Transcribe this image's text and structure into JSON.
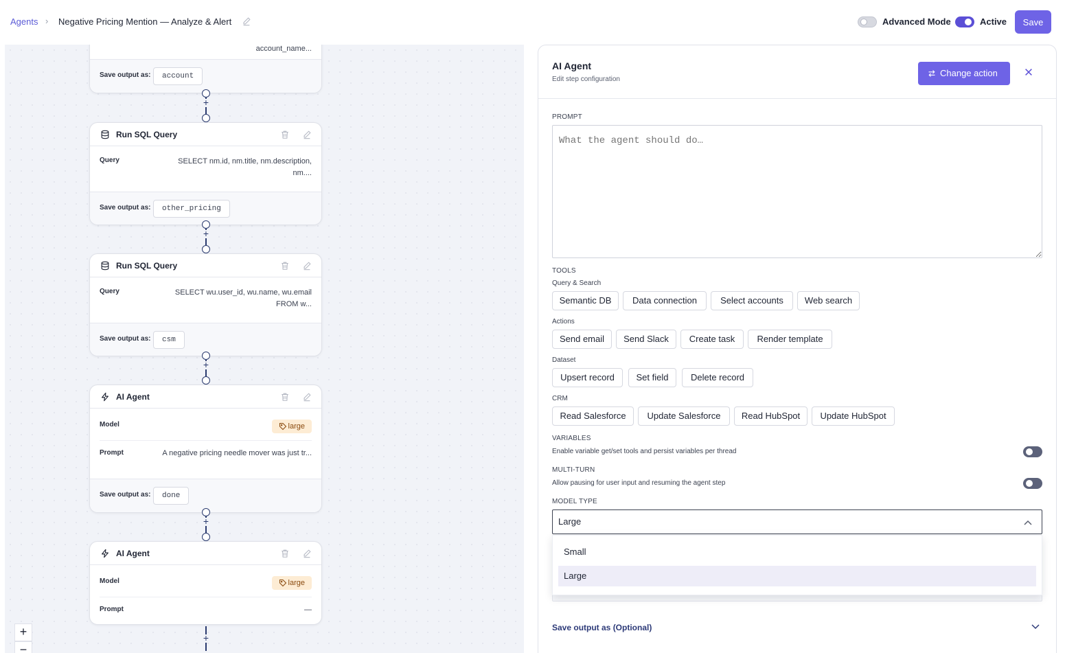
{
  "header": {
    "breadcrumb_root": "Agents",
    "title": "Negative Pricing Mention — Analyze & Alert",
    "advanced_mode_label": "Advanced Mode",
    "advanced_mode_on": false,
    "active_label": "Active",
    "active_on": true,
    "save_label": "Save"
  },
  "canvas": {
    "nodes": [
      {
        "title": "",
        "partial_value": "account_name...",
        "save_label": "Save output as:",
        "save_value": "account"
      },
      {
        "title": "Run SQL Query",
        "icon": "database-icon",
        "rows": [
          {
            "label": "Query",
            "value": "SELECT nm.id, nm.title, nm.description, nm...."
          }
        ],
        "save_label": "Save output as:",
        "save_value": "other_pricing"
      },
      {
        "title": "Run SQL Query",
        "icon": "database-icon",
        "rows": [
          {
            "label": "Query",
            "value": "SELECT wu.user_id, wu.name, wu.email FROM w..."
          }
        ],
        "save_label": "Save output as:",
        "save_value": "csm"
      },
      {
        "title": "AI Agent",
        "icon": "lightning-icon",
        "rows": [
          {
            "label": "Model",
            "tag": "large"
          },
          {
            "label": "Prompt",
            "value": "A negative pricing needle mover was just tr..."
          }
        ],
        "save_label": "Save output as:",
        "save_value": "done"
      },
      {
        "title": "AI Agent",
        "icon": "lightning-icon",
        "rows": [
          {
            "label": "Model",
            "tag": "large"
          },
          {
            "label": "Prompt",
            "value": "—"
          }
        ]
      }
    ],
    "zoom_in": "+",
    "zoom_out": "−"
  },
  "panel": {
    "title": "AI Agent",
    "subtitle": "Edit step configuration",
    "change_action_label": "Change action",
    "prompt_label": "PROMPT",
    "prompt_placeholder": "What the agent should do…",
    "tools_label": "TOOLS",
    "groups": [
      {
        "name": "Query & Search",
        "chips": [
          "Semantic DB",
          "Data connection",
          "Select accounts",
          "Web search"
        ]
      },
      {
        "name": "Actions",
        "chips": [
          "Send email",
          "Send Slack",
          "Create task",
          "Render template"
        ]
      },
      {
        "name": "Dataset",
        "chips": [
          "Upsert record",
          "Set field",
          "Delete record"
        ]
      },
      {
        "name": "CRM",
        "chips": [
          "Read Salesforce",
          "Update Salesforce",
          "Read HubSpot",
          "Update HubSpot"
        ]
      }
    ],
    "variables_label": "VARIABLES",
    "variables_desc": "Enable variable get/set tools and persist variables per thread",
    "multiturn_label": "MULTI-TURN",
    "multiturn_desc": "Allow pausing for user input and resuming the agent step",
    "model_type_label": "MODEL TYPE",
    "model_type_value": "Large",
    "model_options": [
      "Small",
      "Large"
    ],
    "model_selected": "Large",
    "save_output_label": "Save output as (Optional)"
  },
  "colors": {
    "accent": "#6e63e6",
    "connector": "#2a3a6e",
    "tag_bg": "#fdecd4"
  }
}
